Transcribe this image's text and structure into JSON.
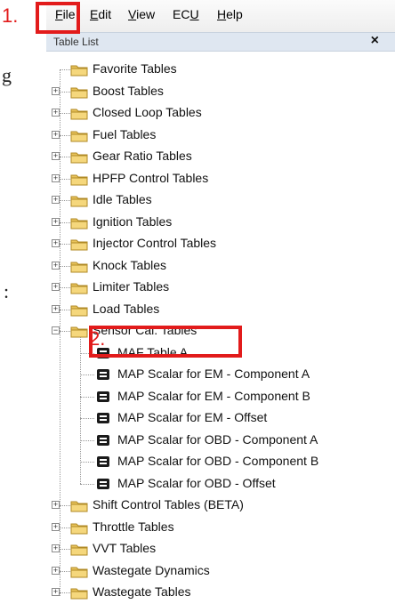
{
  "left_fragments": [
    "g",
    ":"
  ],
  "annotations": {
    "step1": "1.",
    "step2": "2."
  },
  "menu": [
    {
      "label": "File",
      "u": "F",
      "rest": "ile"
    },
    {
      "label": "Edit",
      "u": "E",
      "rest": "dit"
    },
    {
      "label": "View",
      "u": "V",
      "rest": "iew"
    },
    {
      "label": "ECU",
      "pre": "EC",
      "u": "U"
    },
    {
      "label": "Help",
      "u": "H",
      "rest": "elp"
    }
  ],
  "panel": {
    "title": "Table List",
    "close": "×"
  },
  "tree": {
    "folders_top": [
      "Favorite Tables",
      "Boost Tables",
      "Closed Loop Tables",
      "Fuel Tables",
      "Gear Ratio Tables",
      "HPFP Control Tables",
      "Idle Tables",
      "Ignition Tables",
      "Injector Control Tables",
      "Knock Tables",
      "Limiter Tables",
      "Load Tables",
      "Sensor Cal. Tables"
    ],
    "sensor_children": [
      "MAF Table A",
      "MAP Scalar for EM - Component A",
      "MAP Scalar for EM - Component B",
      "MAP Scalar for EM - Offset",
      "MAP Scalar for OBD - Component A",
      "MAP Scalar for OBD - Component B",
      "MAP Scalar for OBD - Offset"
    ],
    "folders_bottom": [
      "Shift Control Tables (BETA)",
      "Throttle Tables",
      "VVT Tables",
      "Wastegate Dynamics",
      "Wastegate Tables"
    ],
    "expand_plus": "+",
    "expand_minus": "−"
  },
  "colors": {
    "highlight": "#e21b1b",
    "folder": "#e8c35a"
  }
}
